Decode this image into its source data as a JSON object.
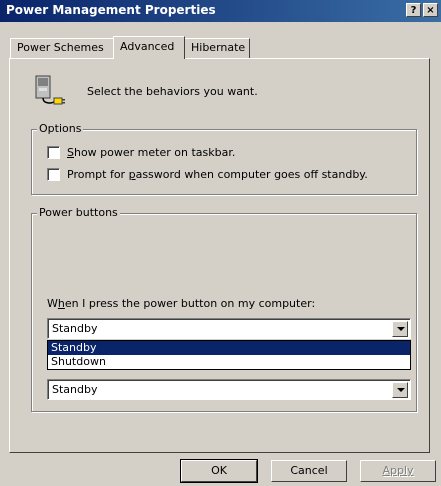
{
  "window": {
    "title": "Power Management Properties",
    "help_label": "?",
    "close_label": "×"
  },
  "tabs": [
    {
      "label": "Power Schemes"
    },
    {
      "label": "Advanced"
    },
    {
      "label": "Hibernate"
    }
  ],
  "intro": {
    "text": "Select the behaviors you want."
  },
  "options": {
    "legend": "Options",
    "items": [
      {
        "label_pre": "",
        "label_key": "S",
        "label_post": "how power meter on taskbar.",
        "checked": false
      },
      {
        "label_pre": "Prompt for ",
        "label_key": "p",
        "label_post": "assword when computer goes off standby.",
        "checked": false
      }
    ]
  },
  "power_buttons": {
    "legend": "Power buttons",
    "prompt_pre": "W",
    "prompt_key": "h",
    "prompt_post": "en I press the power button on my computer:",
    "power_value": "Standby",
    "dropdown_options": [
      "Standby",
      "Shutdown"
    ],
    "sleep_value": "Standby"
  },
  "buttons": {
    "ok": "OK",
    "cancel": "Cancel",
    "apply": "Apply"
  }
}
